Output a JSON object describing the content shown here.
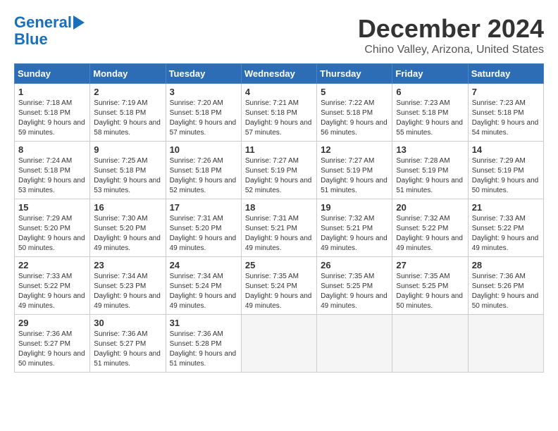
{
  "header": {
    "logo_line1": "General",
    "logo_line2": "Blue",
    "month": "December 2024",
    "location": "Chino Valley, Arizona, United States"
  },
  "weekdays": [
    "Sunday",
    "Monday",
    "Tuesday",
    "Wednesday",
    "Thursday",
    "Friday",
    "Saturday"
  ],
  "weeks": [
    [
      {
        "day": "1",
        "sunrise": "7:18 AM",
        "sunset": "5:18 PM",
        "daylight": "9 hours and 59 minutes."
      },
      {
        "day": "2",
        "sunrise": "7:19 AM",
        "sunset": "5:18 PM",
        "daylight": "9 hours and 58 minutes."
      },
      {
        "day": "3",
        "sunrise": "7:20 AM",
        "sunset": "5:18 PM",
        "daylight": "9 hours and 57 minutes."
      },
      {
        "day": "4",
        "sunrise": "7:21 AM",
        "sunset": "5:18 PM",
        "daylight": "9 hours and 57 minutes."
      },
      {
        "day": "5",
        "sunrise": "7:22 AM",
        "sunset": "5:18 PM",
        "daylight": "9 hours and 56 minutes."
      },
      {
        "day": "6",
        "sunrise": "7:23 AM",
        "sunset": "5:18 PM",
        "daylight": "9 hours and 55 minutes."
      },
      {
        "day": "7",
        "sunrise": "7:23 AM",
        "sunset": "5:18 PM",
        "daylight": "9 hours and 54 minutes."
      }
    ],
    [
      {
        "day": "8",
        "sunrise": "7:24 AM",
        "sunset": "5:18 PM",
        "daylight": "9 hours and 53 minutes."
      },
      {
        "day": "9",
        "sunrise": "7:25 AM",
        "sunset": "5:18 PM",
        "daylight": "9 hours and 53 minutes."
      },
      {
        "day": "10",
        "sunrise": "7:26 AM",
        "sunset": "5:18 PM",
        "daylight": "9 hours and 52 minutes."
      },
      {
        "day": "11",
        "sunrise": "7:27 AM",
        "sunset": "5:19 PM",
        "daylight": "9 hours and 52 minutes."
      },
      {
        "day": "12",
        "sunrise": "7:27 AM",
        "sunset": "5:19 PM",
        "daylight": "9 hours and 51 minutes."
      },
      {
        "day": "13",
        "sunrise": "7:28 AM",
        "sunset": "5:19 PM",
        "daylight": "9 hours and 51 minutes."
      },
      {
        "day": "14",
        "sunrise": "7:29 AM",
        "sunset": "5:19 PM",
        "daylight": "9 hours and 50 minutes."
      }
    ],
    [
      {
        "day": "15",
        "sunrise": "7:29 AM",
        "sunset": "5:20 PM",
        "daylight": "9 hours and 50 minutes."
      },
      {
        "day": "16",
        "sunrise": "7:30 AM",
        "sunset": "5:20 PM",
        "daylight": "9 hours and 49 minutes."
      },
      {
        "day": "17",
        "sunrise": "7:31 AM",
        "sunset": "5:20 PM",
        "daylight": "9 hours and 49 minutes."
      },
      {
        "day": "18",
        "sunrise": "7:31 AM",
        "sunset": "5:21 PM",
        "daylight": "9 hours and 49 minutes."
      },
      {
        "day": "19",
        "sunrise": "7:32 AM",
        "sunset": "5:21 PM",
        "daylight": "9 hours and 49 minutes."
      },
      {
        "day": "20",
        "sunrise": "7:32 AM",
        "sunset": "5:22 PM",
        "daylight": "9 hours and 49 minutes."
      },
      {
        "day": "21",
        "sunrise": "7:33 AM",
        "sunset": "5:22 PM",
        "daylight": "9 hours and 49 minutes."
      }
    ],
    [
      {
        "day": "22",
        "sunrise": "7:33 AM",
        "sunset": "5:22 PM",
        "daylight": "9 hours and 49 minutes."
      },
      {
        "day": "23",
        "sunrise": "7:34 AM",
        "sunset": "5:23 PM",
        "daylight": "9 hours and 49 minutes."
      },
      {
        "day": "24",
        "sunrise": "7:34 AM",
        "sunset": "5:24 PM",
        "daylight": "9 hours and 49 minutes."
      },
      {
        "day": "25",
        "sunrise": "7:35 AM",
        "sunset": "5:24 PM",
        "daylight": "9 hours and 49 minutes."
      },
      {
        "day": "26",
        "sunrise": "7:35 AM",
        "sunset": "5:25 PM",
        "daylight": "9 hours and 49 minutes."
      },
      {
        "day": "27",
        "sunrise": "7:35 AM",
        "sunset": "5:25 PM",
        "daylight": "9 hours and 50 minutes."
      },
      {
        "day": "28",
        "sunrise": "7:36 AM",
        "sunset": "5:26 PM",
        "daylight": "9 hours and 50 minutes."
      }
    ],
    [
      {
        "day": "29",
        "sunrise": "7:36 AM",
        "sunset": "5:27 PM",
        "daylight": "9 hours and 50 minutes."
      },
      {
        "day": "30",
        "sunrise": "7:36 AM",
        "sunset": "5:27 PM",
        "daylight": "9 hours and 51 minutes."
      },
      {
        "day": "31",
        "sunrise": "7:36 AM",
        "sunset": "5:28 PM",
        "daylight": "9 hours and 51 minutes."
      },
      null,
      null,
      null,
      null
    ]
  ]
}
